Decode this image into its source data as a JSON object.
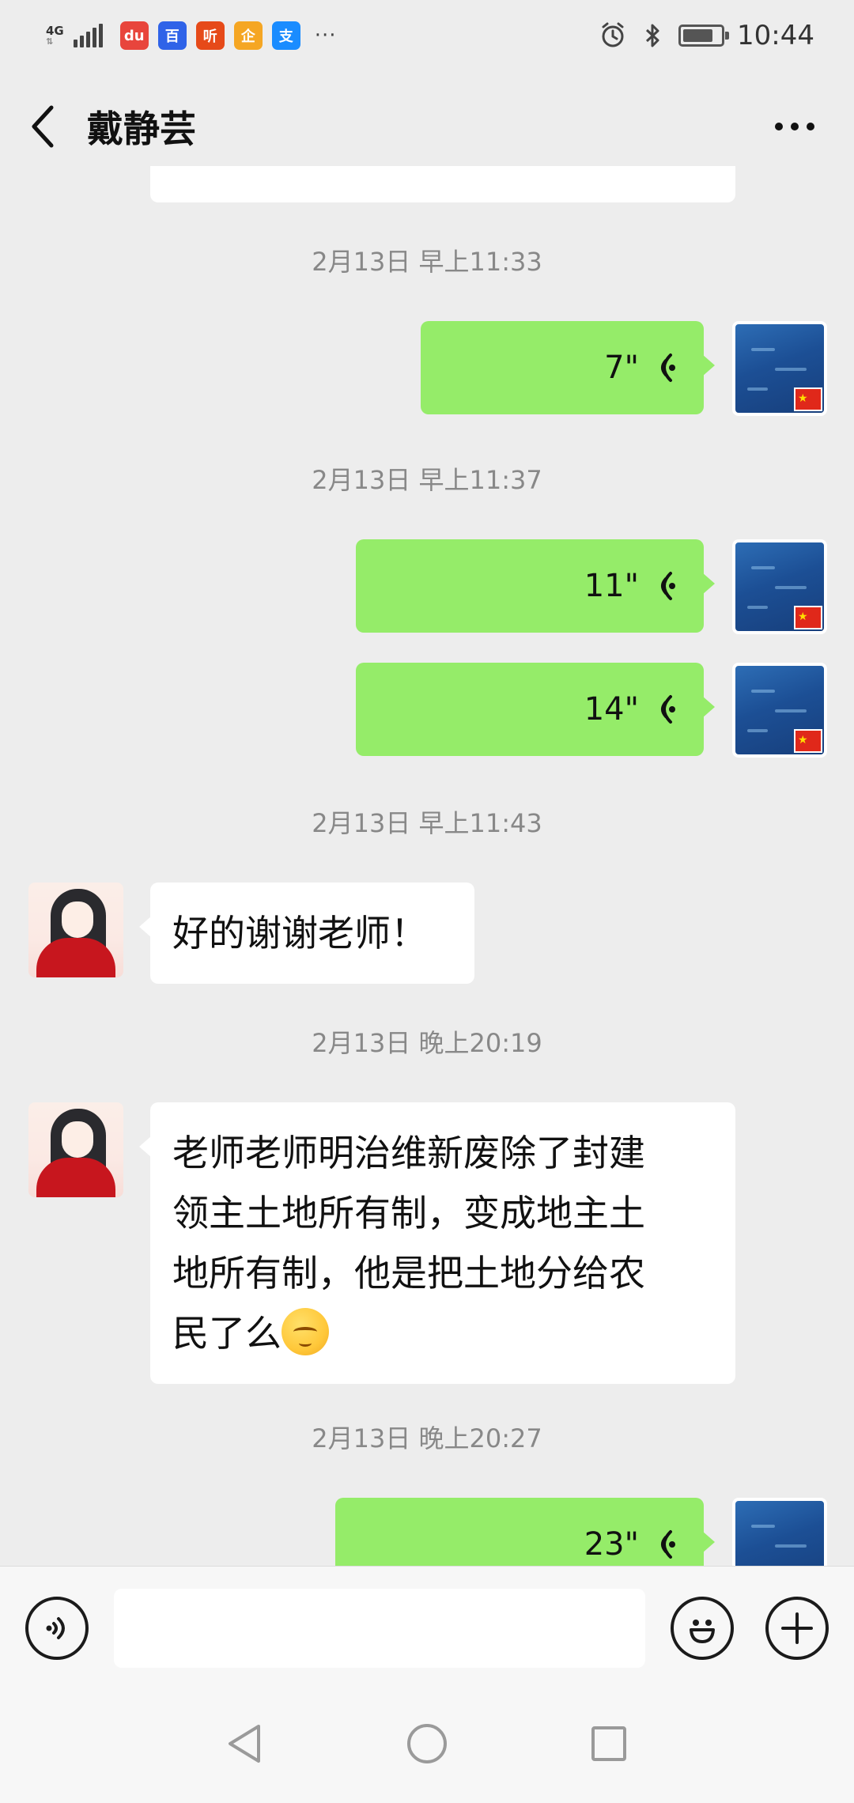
{
  "status_bar": {
    "network": "4G",
    "app_icons": [
      {
        "name": "baidu-map-icon",
        "glyph": "du",
        "color": "#e8453c"
      },
      {
        "name": "baidu-icon",
        "glyph": "百",
        "color": "#2f63e8"
      },
      {
        "name": "listen-app-icon",
        "glyph": "听",
        "color": "#e64a19"
      },
      {
        "name": "penguin-app-icon",
        "glyph": "企",
        "color": "#f5a623"
      },
      {
        "name": "alipay-icon",
        "glyph": "支",
        "color": "#1a8cff"
      }
    ],
    "more": "···",
    "battery_level": 0.8,
    "time": "10:44"
  },
  "header": {
    "title": "戴静芸"
  },
  "messages": [
    {
      "kind": "timestamp",
      "text": "2月13日 早上11:33"
    },
    {
      "kind": "voice",
      "sender": "me",
      "duration": "7\""
    },
    {
      "kind": "timestamp",
      "text": "2月13日 早上11:37"
    },
    {
      "kind": "voice",
      "sender": "me",
      "duration": "11\""
    },
    {
      "kind": "voice",
      "sender": "me",
      "duration": "14\""
    },
    {
      "kind": "timestamp",
      "text": "2月13日 早上11:43"
    },
    {
      "kind": "text",
      "sender": "her",
      "text": "好的谢谢老师！"
    },
    {
      "kind": "timestamp",
      "text": "2月13日 晚上20:19"
    },
    {
      "kind": "text",
      "sender": "her",
      "lines": [
        "老师老师明治维新废除了封建",
        "领主土地所有制，变成地主土",
        "地所有制，他是把土地分给农",
        "民了么"
      ]
    },
    {
      "kind": "timestamp",
      "text": "2月13日 晚上20:27"
    },
    {
      "kind": "voice",
      "sender": "me",
      "duration": "23\""
    }
  ],
  "colors": {
    "my_bubble": "#95ec69",
    "her_bubble": "#ffffff",
    "background": "#ededed"
  }
}
